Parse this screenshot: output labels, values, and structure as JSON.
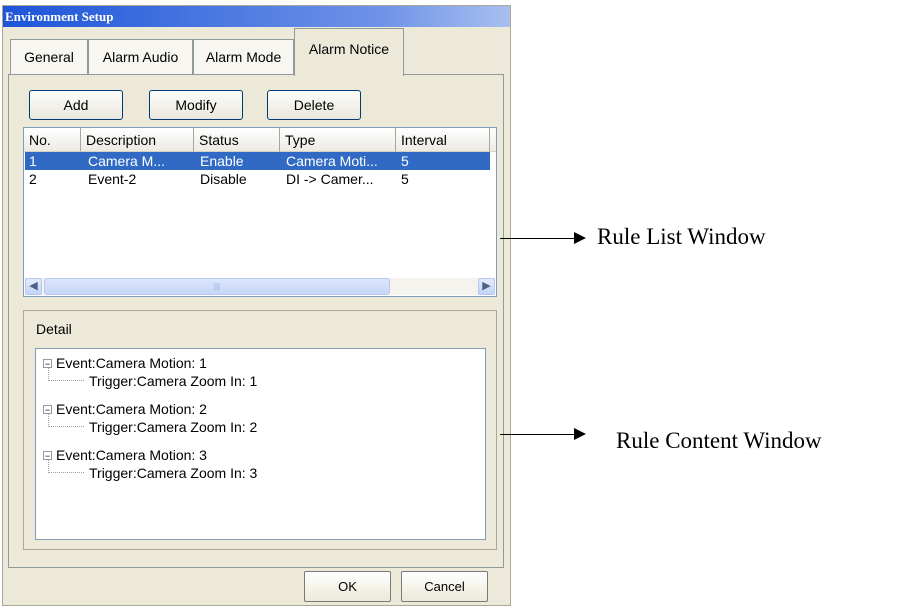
{
  "window": {
    "title": "Environment Setup"
  },
  "tabs": [
    {
      "label": "General"
    },
    {
      "label": "Alarm Audio"
    },
    {
      "label": "Alarm Mode"
    },
    {
      "label": "Alarm Notice"
    }
  ],
  "toolbar": {
    "add": "Add",
    "modify": "Modify",
    "delete": "Delete"
  },
  "rule_list": {
    "columns": [
      "No.",
      "Description",
      "Status",
      "Type",
      "Interval"
    ],
    "rows": [
      {
        "no": "1",
        "description": "Camera M...",
        "status": "Enable",
        "type": "Camera Moti...",
        "interval": "5",
        "selected": true
      },
      {
        "no": "2",
        "description": "Event-2",
        "status": "Disable",
        "type": "DI -> Camer...",
        "interval": "5",
        "selected": false
      }
    ]
  },
  "detail": {
    "label": "Detail",
    "tree": [
      {
        "event": "Event:Camera Motion: 1",
        "trigger": "Trigger:Camera Zoom In: 1"
      },
      {
        "event": "Event:Camera Motion: 2",
        "trigger": "Trigger:Camera Zoom In: 2"
      },
      {
        "event": "Event:Camera Motion: 3",
        "trigger": "Trigger:Camera Zoom In: 3"
      }
    ]
  },
  "footer": {
    "ok": "OK",
    "cancel": "Cancel"
  },
  "annotations": {
    "rule_list": "Rule List Window",
    "rule_content": "Rule Content Window"
  }
}
